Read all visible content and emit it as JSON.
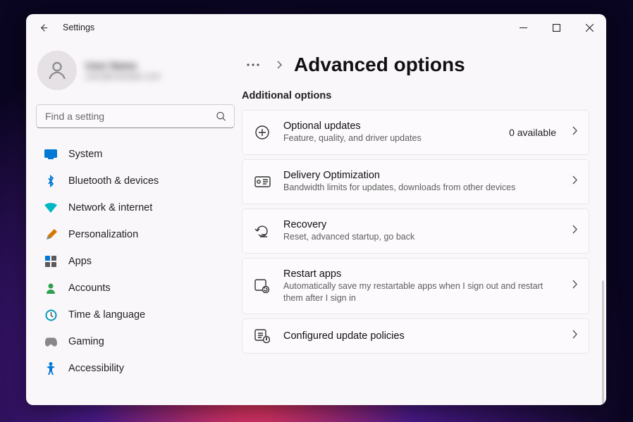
{
  "window": {
    "title": "Settings"
  },
  "profile": {
    "name": "User Name",
    "email": "user@example.com"
  },
  "search": {
    "placeholder": "Find a setting"
  },
  "nav": [
    {
      "icon": "system",
      "label": "System"
    },
    {
      "icon": "bluetooth",
      "label": "Bluetooth & devices"
    },
    {
      "icon": "network",
      "label": "Network & internet"
    },
    {
      "icon": "personalization",
      "label": "Personalization"
    },
    {
      "icon": "apps",
      "label": "Apps"
    },
    {
      "icon": "accounts",
      "label": "Accounts"
    },
    {
      "icon": "time",
      "label": "Time & language"
    },
    {
      "icon": "gaming",
      "label": "Gaming"
    },
    {
      "icon": "accessibility",
      "label": "Accessibility"
    }
  ],
  "breadcrumb": {
    "title": "Advanced options"
  },
  "section_title": "Additional options",
  "cards": [
    {
      "icon": "optional-updates",
      "title": "Optional updates",
      "desc": "Feature, quality, and driver updates",
      "badge": "0 available"
    },
    {
      "icon": "delivery",
      "title": "Delivery Optimization",
      "desc": "Bandwidth limits for updates, downloads from other devices",
      "badge": ""
    },
    {
      "icon": "recovery",
      "title": "Recovery",
      "desc": "Reset, advanced startup, go back",
      "badge": ""
    },
    {
      "icon": "restart-apps",
      "title": "Restart apps",
      "desc": "Automatically save my restartable apps when I sign out and restart them after I sign in",
      "badge": ""
    },
    {
      "icon": "policies",
      "title": "Configured update policies",
      "desc": "",
      "badge": ""
    }
  ]
}
